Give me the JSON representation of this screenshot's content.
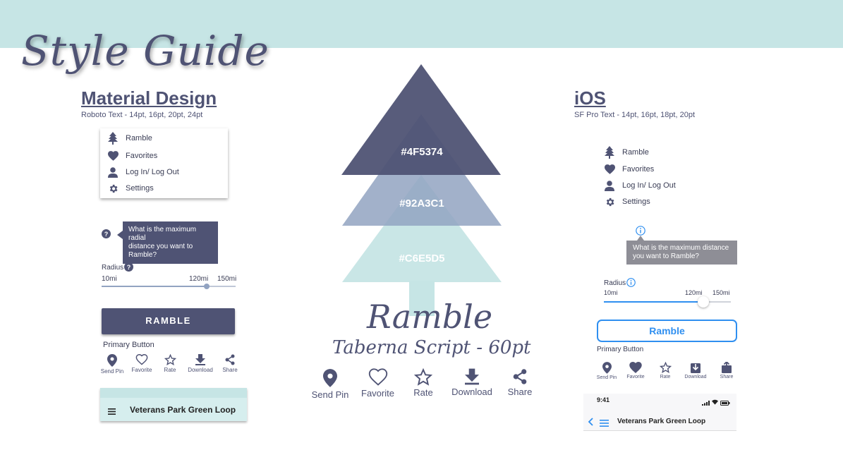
{
  "page": {
    "title": "Style Guide"
  },
  "colors": {
    "primary": "#4F5374",
    "secondary": "#92A3C1",
    "tertiary": "#C6E5E5",
    "ios_blue": "#2f8ff0"
  },
  "material": {
    "title": "Material Design",
    "subtitle": "Roboto Text - 14pt, 16pt, 20pt, 24pt",
    "menu": [
      {
        "icon": "tree-icon",
        "label": "Ramble"
      },
      {
        "icon": "heart-icon",
        "label": "Favorites"
      },
      {
        "icon": "person-icon",
        "label": "Log In/ Log Out"
      },
      {
        "icon": "gear-icon",
        "label": "Settings"
      }
    ],
    "tooltip": {
      "line1": "What is the maximum radial",
      "line2": "distance you want to Ramble?"
    },
    "slider": {
      "label": "Radius",
      "min_label": "10mi",
      "value_label": "120mi",
      "max_label": "150mi",
      "min": 10,
      "max": 150,
      "value": 120
    },
    "button": {
      "label": "RAMBLE",
      "caption": "Primary Button"
    },
    "actions": [
      {
        "icon": "pin-icon",
        "label": "Send Pin"
      },
      {
        "icon": "heart-outline-icon",
        "label": "Favorite"
      },
      {
        "icon": "star-outline-icon",
        "label": "Rate"
      },
      {
        "icon": "download-icon",
        "label": "Download"
      },
      {
        "icon": "share-icon",
        "label": "Share"
      }
    ],
    "appbar": {
      "title": "Veterans Park Green Loop"
    }
  },
  "center": {
    "swatches": [
      "#4F5374",
      "#92A3C1",
      "#C6E5E5"
    ],
    "swatch_labels": [
      "#4F5374",
      "#92A3C1",
      "#C6E5D5"
    ],
    "font_sample": "Ramble",
    "font_caption": "Taberna Script - 60pt",
    "actions": [
      {
        "icon": "pin-icon",
        "label": "Send Pin"
      },
      {
        "icon": "heart-outline-icon",
        "label": "Favorite"
      },
      {
        "icon": "star-outline-icon",
        "label": "Rate"
      },
      {
        "icon": "download-icon",
        "label": "Download"
      },
      {
        "icon": "share-icon",
        "label": "Share"
      }
    ]
  },
  "ios": {
    "title": "iOS",
    "subtitle": "SF Pro Text - 14pt, 16pt, 18pt, 20pt",
    "menu": [
      {
        "icon": "tree-icon",
        "label": "Ramble"
      },
      {
        "icon": "heart-icon",
        "label": "Favorites"
      },
      {
        "icon": "person-icon",
        "label": "Log In/ Log Out"
      },
      {
        "icon": "gear-icon",
        "label": "Settings"
      }
    ],
    "tooltip": {
      "line1": "What is the maximum distance",
      "line2": "you want to Ramble?"
    },
    "slider": {
      "label": "Radius",
      "min_label": "10mi",
      "value_label": "120mi",
      "max_label": "150mi",
      "min": 10,
      "max": 150,
      "value": 120
    },
    "button": {
      "label": "Ramble",
      "caption": "Primary Button"
    },
    "actions": [
      {
        "icon": "pin-icon",
        "label": "Send Pin"
      },
      {
        "icon": "heart-icon",
        "label": "Favorite"
      },
      {
        "icon": "star-outline-icon",
        "label": "Rate"
      },
      {
        "icon": "download-icon",
        "label": "Download"
      },
      {
        "icon": "share-icon",
        "label": "Share"
      }
    ],
    "status_time": "9:41",
    "navbar": {
      "title": "Veterans Park Green Loop"
    }
  }
}
